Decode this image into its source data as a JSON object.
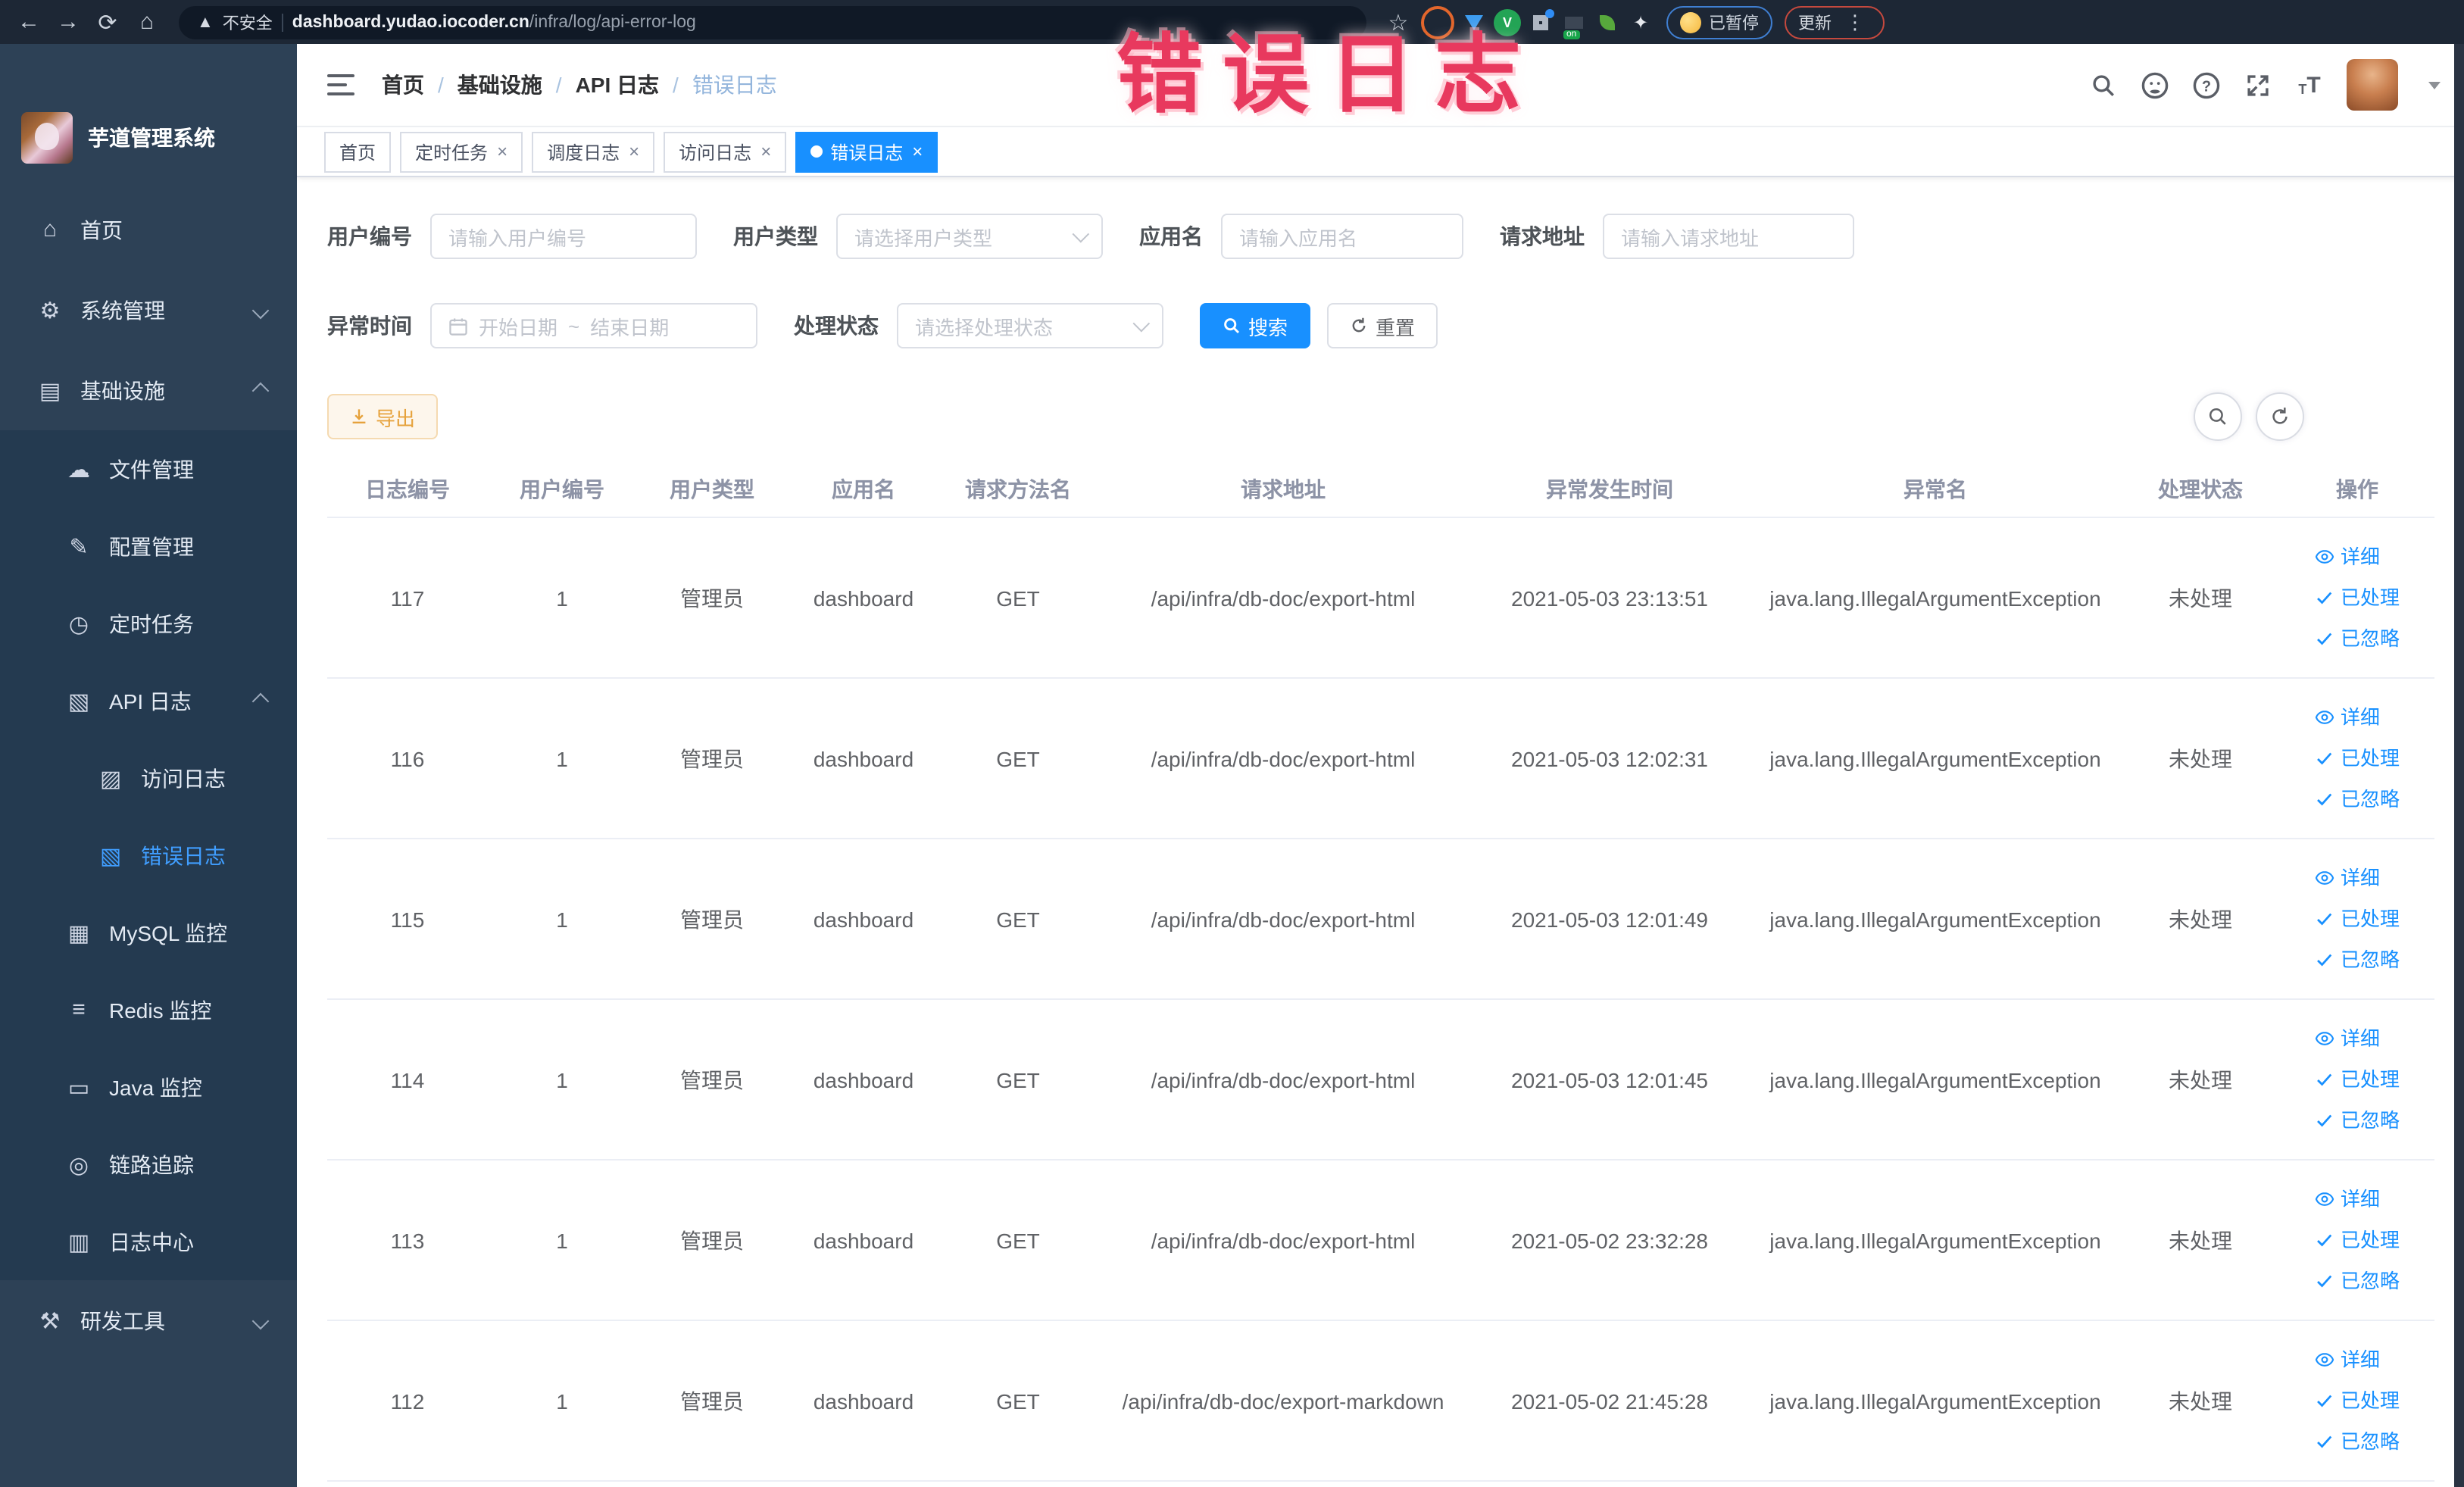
{
  "browser": {
    "security_label": "不安全",
    "url_host": "dashboard.yudao.iocoder.cn",
    "url_path": "/infra/log/api-error-log",
    "paused_badge_label": "已暂停",
    "update_button_label": "更新"
  },
  "overlay": {
    "text": "错误日志"
  },
  "sidebar": {
    "title": "芋道管理系统",
    "menu": [
      {
        "label": "首页",
        "icon": "home-icon"
      },
      {
        "label": "系统管理",
        "icon": "gear-icon",
        "chevron": "down"
      },
      {
        "label": "基础设施",
        "icon": "infra-icon",
        "chevron": "up",
        "children": [
          {
            "label": "文件管理",
            "icon": "file-icon"
          },
          {
            "label": "配置管理",
            "icon": "config-icon"
          },
          {
            "label": "定时任务",
            "icon": "timer-icon"
          },
          {
            "label": "API 日志",
            "icon": "api-log-icon",
            "chevron": "up",
            "children": [
              {
                "label": "访问日志",
                "icon": "access-log-icon"
              },
              {
                "label": "错误日志",
                "icon": "error-log-icon",
                "active": true
              }
            ]
          },
          {
            "label": "MySQL 监控",
            "icon": "mysql-icon"
          },
          {
            "label": "Redis 监控",
            "icon": "redis-icon"
          },
          {
            "label": "Java 监控",
            "icon": "java-icon"
          },
          {
            "label": "链路追踪",
            "icon": "trace-icon"
          },
          {
            "label": "日志中心",
            "icon": "log-center-icon"
          }
        ]
      },
      {
        "label": "研发工具",
        "icon": "tools-icon",
        "chevron": "down"
      }
    ]
  },
  "header": {
    "breadcrumb": [
      "首页",
      "基础设施",
      "API 日志",
      "错误日志"
    ]
  },
  "tabs": [
    {
      "label": "首页",
      "closable": false,
      "active": false
    },
    {
      "label": "定时任务",
      "closable": true,
      "active": false
    },
    {
      "label": "调度日志",
      "closable": true,
      "active": false
    },
    {
      "label": "访问日志",
      "closable": true,
      "active": false
    },
    {
      "label": "错误日志",
      "closable": true,
      "active": true
    }
  ],
  "filters": {
    "row1": [
      {
        "label": "用户编号",
        "placeholder": "请输入用户编号",
        "type": "input"
      },
      {
        "label": "用户类型",
        "placeholder": "请选择用户类型",
        "type": "select"
      },
      {
        "label": "应用名",
        "placeholder": "请输入应用名",
        "type": "input"
      },
      {
        "label": "请求地址",
        "placeholder": "请输入请求地址",
        "type": "input"
      }
    ],
    "time_label": "异常时间",
    "date_start_placeholder": "开始日期",
    "date_separator": "~",
    "date_end_placeholder": "结束日期",
    "status_label": "处理状态",
    "status_placeholder": "请选择处理状态",
    "search_button": "搜索",
    "reset_button": "重置"
  },
  "toolbar": {
    "export_button": "导出"
  },
  "table": {
    "headers": [
      "日志编号",
      "用户编号",
      "用户类型",
      "应用名",
      "请求方法名",
      "请求地址",
      "异常发生时间",
      "异常名",
      "处理状态",
      "操作"
    ],
    "row_actions": [
      "详细",
      "已处理",
      "已忽略"
    ],
    "rows": [
      {
        "id": "117",
        "user_id": "1",
        "user_type": "管理员",
        "app_name": "dashboard",
        "method": "GET",
        "url": "/api/infra/db-doc/export-html",
        "time": "2021-05-03 23:13:51",
        "exception": "java.lang.IllegalArgumentException",
        "status": "未处理"
      },
      {
        "id": "116",
        "user_id": "1",
        "user_type": "管理员",
        "app_name": "dashboard",
        "method": "GET",
        "url": "/api/infra/db-doc/export-html",
        "time": "2021-05-03 12:02:31",
        "exception": "java.lang.IllegalArgumentException",
        "status": "未处理"
      },
      {
        "id": "115",
        "user_id": "1",
        "user_type": "管理员",
        "app_name": "dashboard",
        "method": "GET",
        "url": "/api/infra/db-doc/export-html",
        "time": "2021-05-03 12:01:49",
        "exception": "java.lang.IllegalArgumentException",
        "status": "未处理"
      },
      {
        "id": "114",
        "user_id": "1",
        "user_type": "管理员",
        "app_name": "dashboard",
        "method": "GET",
        "url": "/api/infra/db-doc/export-html",
        "time": "2021-05-03 12:01:45",
        "exception": "java.lang.IllegalArgumentException",
        "status": "未处理"
      },
      {
        "id": "113",
        "user_id": "1",
        "user_type": "管理员",
        "app_name": "dashboard",
        "method": "GET",
        "url": "/api/infra/db-doc/export-html",
        "time": "2021-05-02 23:32:28",
        "exception": "java.lang.IllegalArgumentException",
        "status": "未处理"
      },
      {
        "id": "112",
        "user_id": "1",
        "user_type": "管理员",
        "app_name": "dashboard",
        "method": "GET",
        "url": "/api/infra/db-doc/export-markdown",
        "time": "2021-05-02 21:45:28",
        "exception": "java.lang.IllegalArgumentException",
        "status": "未处理"
      }
    ]
  },
  "colors": {
    "primary": "#1890ff",
    "menu_active": "#409eff",
    "warning": "#e6a23c",
    "annotation": "#e8395e"
  }
}
